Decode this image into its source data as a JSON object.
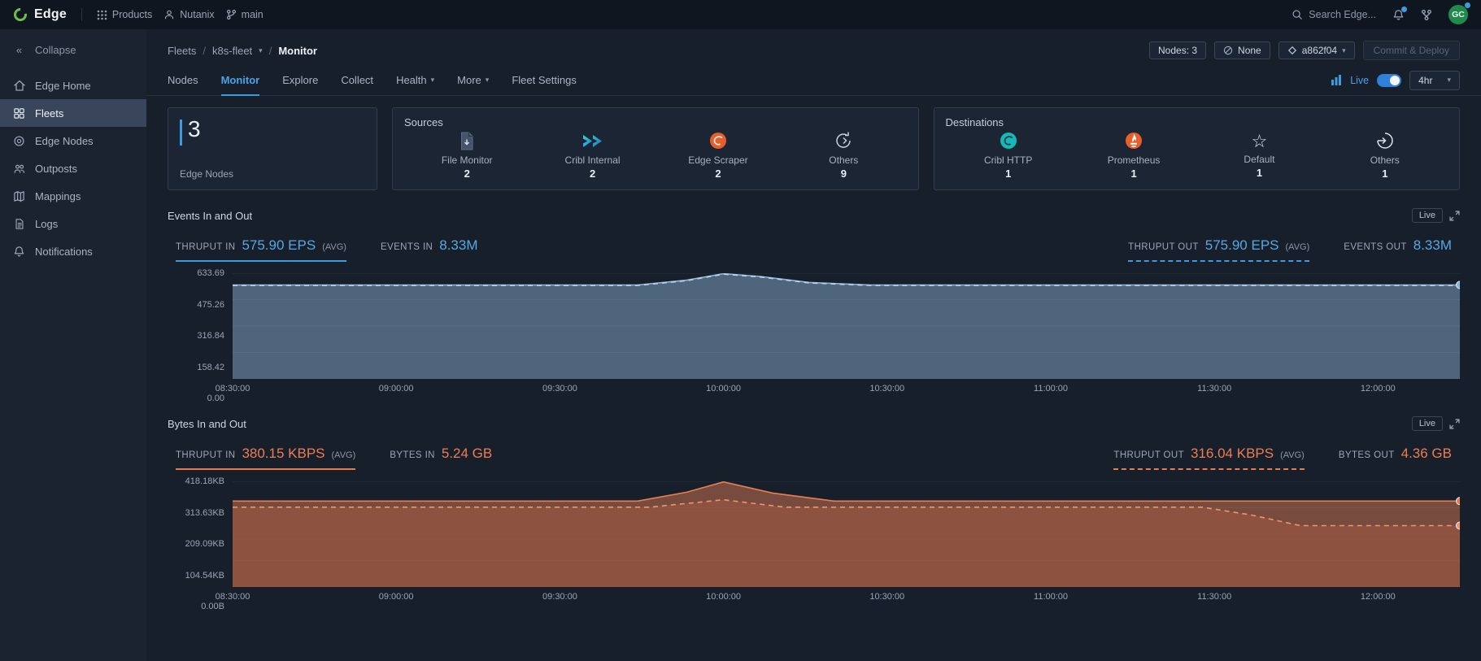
{
  "topbar": {
    "brand": "Edge",
    "nav": [
      {
        "label": "Products"
      },
      {
        "label": "Nutanix"
      },
      {
        "label": "main"
      }
    ],
    "search_placeholder": "Search Edge...",
    "avatar_initials": "GC"
  },
  "sidebar": {
    "collapse_label": "Collapse",
    "items": [
      {
        "label": "Edge Home"
      },
      {
        "label": "Fleets"
      },
      {
        "label": "Edge Nodes"
      },
      {
        "label": "Outposts"
      },
      {
        "label": "Mappings"
      },
      {
        "label": "Logs"
      },
      {
        "label": "Notifications"
      }
    ]
  },
  "header": {
    "breadcrumb": {
      "root": "Fleets",
      "fleet": "k8s-fleet",
      "current": "Monitor"
    },
    "nodes_badge": "Nodes: 3",
    "none_badge": "None",
    "commit_hash": "a862f04",
    "deploy_button": "Commit & Deploy"
  },
  "tabs": [
    {
      "label": "Nodes"
    },
    {
      "label": "Monitor"
    },
    {
      "label": "Explore"
    },
    {
      "label": "Collect"
    },
    {
      "label": "Health"
    },
    {
      "label": "More"
    },
    {
      "label": "Fleet Settings"
    }
  ],
  "controls": {
    "live_label": "Live",
    "time_range": "4hr"
  },
  "summary": {
    "edge_nodes": {
      "count": "3",
      "label": "Edge Nodes"
    },
    "sources": {
      "title": "Sources",
      "items": [
        {
          "label": "File Monitor",
          "count": "2"
        },
        {
          "label": "Cribl Internal",
          "count": "2"
        },
        {
          "label": "Edge Scraper",
          "count": "2"
        },
        {
          "label": "Others",
          "count": "9"
        }
      ]
    },
    "destinations": {
      "title": "Destinations",
      "items": [
        {
          "label": "Cribl HTTP",
          "count": "1"
        },
        {
          "label": "Prometheus",
          "count": "1"
        },
        {
          "label": "Default",
          "count": "1"
        },
        {
          "label": "Others",
          "count": "1"
        }
      ]
    }
  },
  "events_section": {
    "title": "Events In and Out",
    "live": "Live",
    "stats": {
      "in_label": "THRUPUT IN",
      "in_value": "575.90 EPS",
      "in_avg": "(AVG)",
      "events_in_label": "EVENTS IN",
      "events_in_value": "8.33M",
      "out_label": "THRUPUT OUT",
      "out_value": "575.90 EPS",
      "out_avg": "(AVG)",
      "events_out_label": "EVENTS OUT",
      "events_out_value": "8.33M"
    }
  },
  "bytes_section": {
    "title": "Bytes In and Out",
    "live": "Live",
    "stats": {
      "in_label": "THRUPUT IN",
      "in_value": "380.15 KBPS",
      "in_avg": "(AVG)",
      "bytes_in_label": "BYTES IN",
      "bytes_in_value": "5.24 GB",
      "out_label": "THRUPUT OUT",
      "out_value": "316.04 KBPS",
      "out_avg": "(AVG)",
      "bytes_out_label": "BYTES OUT",
      "bytes_out_value": "4.36 GB"
    }
  },
  "accent_colors": {
    "blue": "#3d9ae0",
    "orange": "#e87a4e"
  },
  "chart_data": [
    {
      "type": "area",
      "title": "Events In and Out",
      "ylabel": "EPS",
      "legend_position": "none",
      "grid": "horizontal",
      "x_ticks": [
        "08:30:00",
        "09:00:00",
        "09:30:00",
        "10:00:00",
        "10:30:00",
        "11:00:00",
        "11:30:00",
        "12:00:00"
      ],
      "x_tick_pos": [
        0,
        0.1333,
        0.2667,
        0.4,
        0.5333,
        0.6667,
        0.8,
        0.9333
      ],
      "y_ticks": [
        0,
        158.42,
        316.84,
        475.26,
        633.69
      ],
      "y_tick_labels": [
        "0.00",
        "158.42",
        "316.84",
        "475.26",
        "633.69"
      ],
      "ylim": [
        0,
        633.69
      ],
      "series": [
        {
          "name": "thruput-in",
          "style": "solid",
          "color": "#8fb6da",
          "fill": "rgba(124,158,192,0.55)",
          "end_dot": true,
          "x": [
            0,
            0.33,
            0.37,
            0.4,
            0.43,
            0.47,
            0.52,
            1.0
          ],
          "y": [
            563,
            563,
            592,
            631,
            614,
            578,
            563,
            563
          ]
        },
        {
          "name": "thruput-out",
          "style": "dashed",
          "color": "#b9d3ec",
          "x": [
            0,
            0.33,
            0.37,
            0.4,
            0.43,
            0.47,
            0.52,
            1.0
          ],
          "y": [
            560,
            560,
            589,
            628,
            611,
            575,
            560,
            560
          ]
        }
      ]
    },
    {
      "type": "area",
      "title": "Bytes In and Out",
      "ylabel": "KBps",
      "legend_position": "none",
      "grid": "horizontal",
      "x_ticks": [
        "08:30:00",
        "09:00:00",
        "09:30:00",
        "10:00:00",
        "10:30:00",
        "11:00:00",
        "11:30:00",
        "12:00:00"
      ],
      "x_tick_pos": [
        0,
        0.1333,
        0.2667,
        0.4,
        0.5333,
        0.6667,
        0.8,
        0.9333
      ],
      "y_ticks": [
        0,
        104.54,
        209.09,
        313.63,
        418.18
      ],
      "y_tick_labels": [
        "0.00B",
        "104.54KB",
        "209.09KB",
        "313.63KB",
        "418.18KB"
      ],
      "ylim": [
        0,
        418.18
      ],
      "series": [
        {
          "name": "thruput-in",
          "style": "solid",
          "color": "#e87f52",
          "fill": "rgba(216,122,84,0.50)",
          "end_dot": true,
          "x": [
            0,
            0.33,
            0.37,
            0.4,
            0.44,
            0.49,
            1.0
          ],
          "y": [
            340,
            340,
            375,
            416,
            372,
            340,
            340
          ]
        },
        {
          "name": "thruput-out",
          "style": "dashed",
          "color": "#f0946a",
          "fill": "rgba(170,90,66,0.45)",
          "end_dot": true,
          "x": [
            0,
            0.34,
            0.4,
            0.45,
            0.79,
            0.83,
            0.87,
            1.0
          ],
          "y": [
            316,
            316,
            345,
            316,
            316,
            285,
            243,
            243
          ]
        }
      ]
    }
  ]
}
